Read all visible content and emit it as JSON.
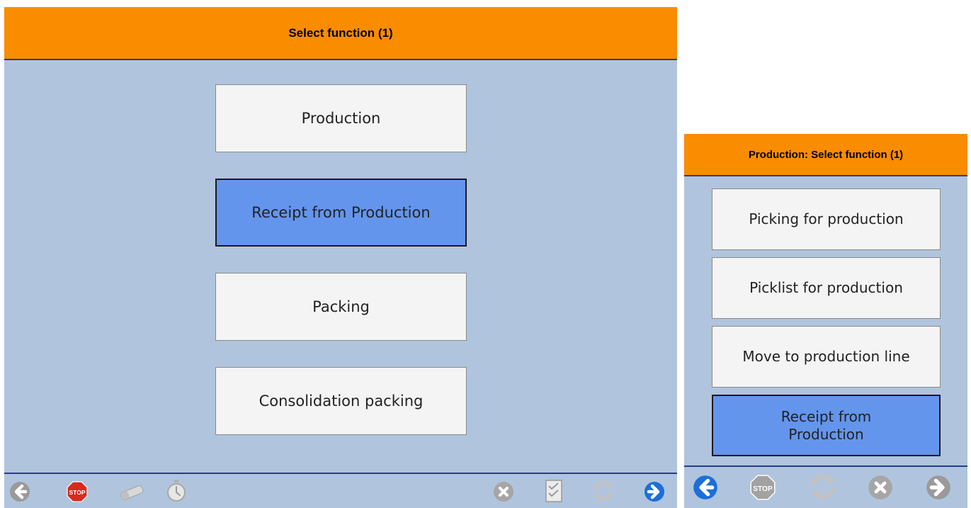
{
  "main_screen": {
    "title": "Select function (1)",
    "buttons": [
      {
        "label": "Production",
        "selected": false
      },
      {
        "label": "Receipt from Production",
        "selected": true
      },
      {
        "label": "Packing",
        "selected": false
      },
      {
        "label": "Consolidation packing",
        "selected": false
      }
    ],
    "toolbar_icons": [
      "back-icon",
      "stop-icon",
      "eraser-icon",
      "stopwatch-icon",
      "cancel-icon",
      "checklist-icon",
      "refresh-icon",
      "forward-icon"
    ]
  },
  "production_screen": {
    "title": "Production: Select function (1)",
    "buttons": [
      {
        "label": "Picking for production",
        "selected": false
      },
      {
        "label": "Picklist for production",
        "selected": false
      },
      {
        "label": "Move to production line",
        "selected": false
      },
      {
        "label": "Receipt from\nProduction",
        "selected": true
      }
    ],
    "toolbar_icons": [
      "back-icon",
      "stop-icon",
      "refresh-icon",
      "cancel-icon",
      "forward-icon"
    ],
    "stop_text": "STOP"
  },
  "colors": {
    "header_bg": "#fa8c00",
    "panel_bg": "#b0c4de",
    "button_bg": "#f4f4f4",
    "selected_button_bg": "#6495ed",
    "divider": "#283c8c"
  }
}
